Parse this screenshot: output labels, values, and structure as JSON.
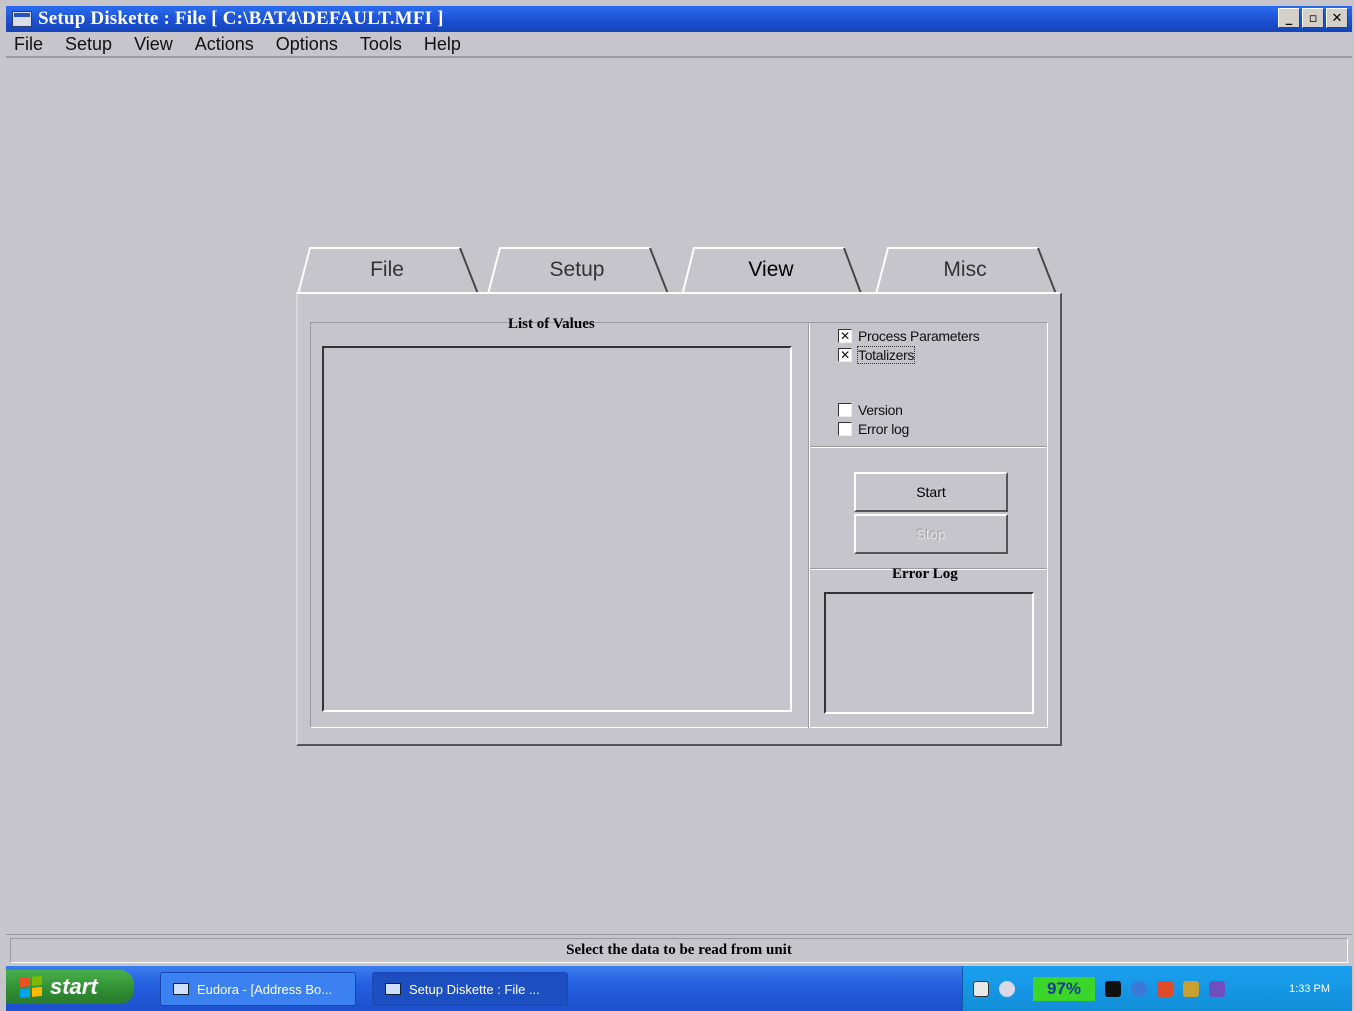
{
  "window": {
    "title": "Setup Diskette : File [ C:\\BAT4\\DEFAULT.MFI ]",
    "controls": {
      "minimize": "_",
      "maximize": "▫",
      "close": "✕"
    }
  },
  "menubar": {
    "items": [
      "File",
      "Setup",
      "View",
      "Actions",
      "Options",
      "Tools",
      "Help"
    ]
  },
  "tabs": [
    {
      "label": "File",
      "active": false
    },
    {
      "label": "Setup",
      "active": false
    },
    {
      "label": "View",
      "active": true
    },
    {
      "label": "Misc",
      "active": false
    }
  ],
  "view_tab": {
    "list_title": "List of Values",
    "checkboxes": [
      {
        "label": "Process Parameters",
        "checked": true
      },
      {
        "label": "Totalizers",
        "checked": true
      },
      {
        "label": "Version",
        "checked": false
      },
      {
        "label": "Error log",
        "checked": false
      }
    ],
    "start_button": "Start",
    "stop_button": "Stop",
    "error_log_title": "Error Log"
  },
  "status": {
    "text": "Select the data to be read from unit"
  },
  "taskbar": {
    "start_label": "start",
    "tasks": [
      {
        "label": "Eudora - [Address Bo..."
      },
      {
        "label": "Setup Diskette : File ..."
      }
    ],
    "battery": "97%",
    "clock": "1:33 PM"
  },
  "colors": {
    "face": "#c6c5cb",
    "titlebar": "#1c4fd0",
    "taskbar": "#2560e0",
    "start": "#2f8d32",
    "tray": "#118ed8"
  }
}
